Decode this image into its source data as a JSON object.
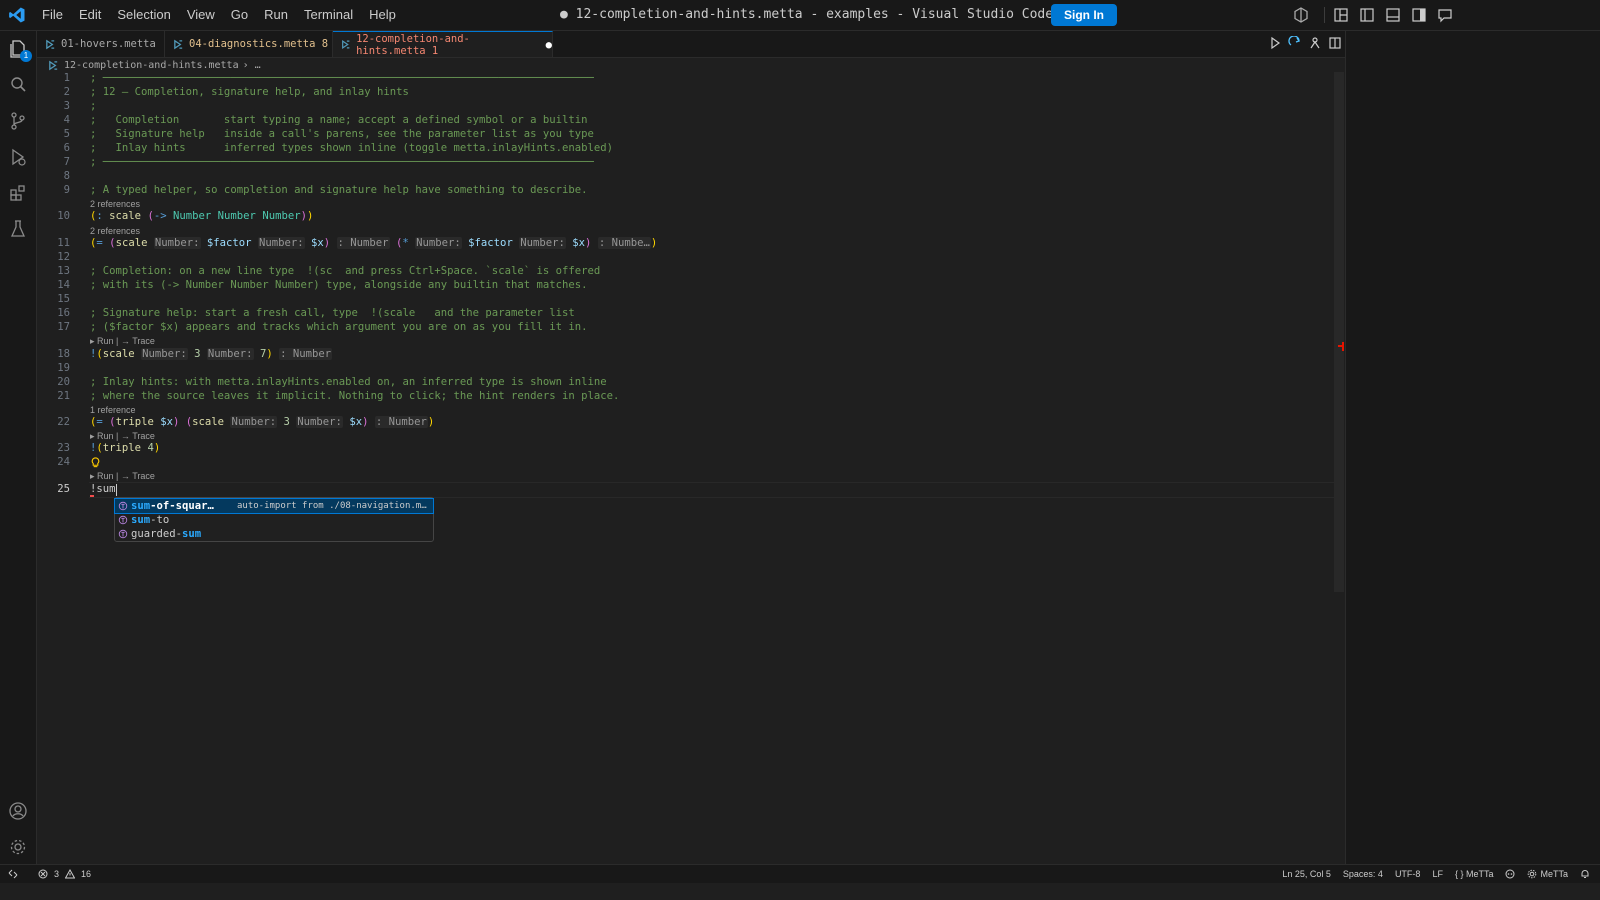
{
  "window": {
    "title": "● 12-completion-and-hints.metta - examples - Visual Studio Code",
    "sign_in": "Sign In",
    "menu": [
      "File",
      "Edit",
      "Selection",
      "View",
      "Go",
      "Run",
      "Terminal",
      "Help"
    ]
  },
  "activity": {
    "explorer_badge": "1"
  },
  "tabs": [
    {
      "label": "01-hovers.metta",
      "color": "#a9a9a9"
    },
    {
      "label": "04-diagnostics.metta 8",
      "color": "#e2c08d"
    },
    {
      "label": "12-completion-and-hints.metta 1",
      "dirty": "●",
      "color": "#f48771"
    }
  ],
  "breadcrumb": {
    "file": "12-completion-and-hints.metta",
    "tail": "› …"
  },
  "lines": {
    "l1": "; ─────────────────────────────────────────────────────────────────────────────",
    "l2": "; 12 — Completion, signature help, and inlay hints",
    "l3": ";",
    "l4": ";   Completion       start typing a name; accept a defined symbol or a builtin",
    "l5": ";   Signature help   inside a call's parens, see the parameter list as you type",
    "l6": ";   Inlay hints      inferred types shown inline (toggle metta.inlayHints.enabled)",
    "l7": "; ─────────────────────────────────────────────────────────────────────────────",
    "l9": "; A typed helper, so completion and signature help have something to describe.",
    "l13": "; Completion: on a new line type  !(sc  and press Ctrl+Space. `scale` is offered",
    "l14": "; with its (-> Number Number Number) type, alongside any builtin that matches.",
    "l16": "; Signature help: start a fresh call, type  !(scale   and the parameter list",
    "l17": "; ($factor $x) appears and tracks which argument you are on as you fill it in.",
    "l20": "; Inlay hints: with metta.inlayHints.enabled on, an inferred type is shown inline",
    "l21": "; where the source leaves it implicit. Nothing to click; the hint renders in place.",
    "l25": "!sum"
  },
  "lens": {
    "refs2": "2 references",
    "refs1": "1 reference",
    "run_trace": "▸ Run | → Trace"
  },
  "tokens": {
    "colon": ":",
    "eq": "=",
    "bang": "!",
    "arrow": "->",
    "scale": "scale",
    "triple": "triple",
    "number": "Number",
    "number_trunc": "Numbe…",
    "star": "*",
    "factor": "$factor",
    "x": "$x",
    "three": "3",
    "four": "4",
    "seven": "7",
    "hint_number": "Number:",
    "hint_ret": ": Number",
    "open": "(",
    "close": ")"
  },
  "suggest": {
    "items": [
      {
        "match": "sum",
        "rest": "-of-squar…",
        "detail": "auto-import from ./08-navigation.m…"
      },
      {
        "match": "sum",
        "rest": "-to",
        "detail": ""
      },
      {
        "pre": "guarded-",
        "match": "sum",
        "detail": ""
      }
    ]
  },
  "status": {
    "errors": "3",
    "warnings": "16",
    "position": "Ln 25, Col 5",
    "spaces": "Spaces: 4",
    "encoding": "UTF-8",
    "eol": "LF",
    "language": "{ } MeTTa",
    "lang_server": "MeTTa"
  }
}
